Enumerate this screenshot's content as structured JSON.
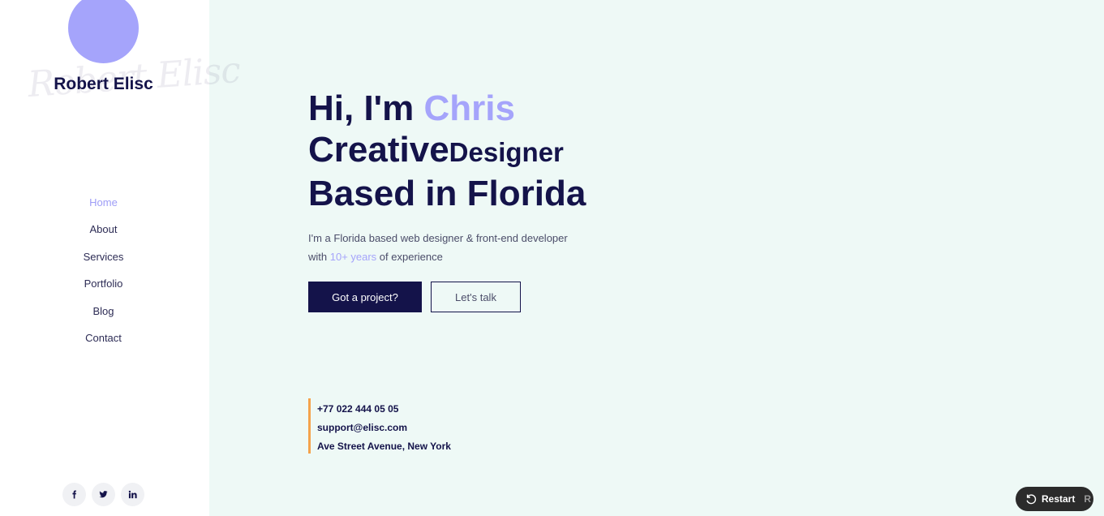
{
  "sidebar": {
    "signature": "Robert Elisc",
    "name": "Robert Elisc",
    "nav": [
      {
        "label": "Home",
        "active": true
      },
      {
        "label": "About"
      },
      {
        "label": "Services"
      },
      {
        "label": "Portfolio"
      },
      {
        "label": "Blog"
      },
      {
        "label": "Contact"
      }
    ],
    "socials": [
      {
        "icon": "facebook-icon"
      },
      {
        "icon": "twitter-icon"
      },
      {
        "icon": "linkedin-icon"
      }
    ]
  },
  "hero": {
    "greeting": "Hi, I'm ",
    "name": "Chris",
    "role_big": "Creative",
    "role_small": "Designer",
    "location": "Based in Florida",
    "intro_line1": "I'm a Florida based web designer & front-end developer",
    "intro_pre": "with ",
    "intro_highlight": "10+ years",
    "intro_post": " of experience"
  },
  "buttons": {
    "primary": "Got a project?",
    "secondary": "Let's talk"
  },
  "contact": {
    "phone": "+77 022 444 05 05",
    "email": "support@elisc.com",
    "address": "Ave Street Avenue, New York"
  },
  "restart": {
    "label": "Restart",
    "shortcut": "R"
  },
  "colors": {
    "accent": "#a5a4fb",
    "navy": "#14134a",
    "background": "#eef9f6",
    "border_accent": "#f5a34c"
  }
}
